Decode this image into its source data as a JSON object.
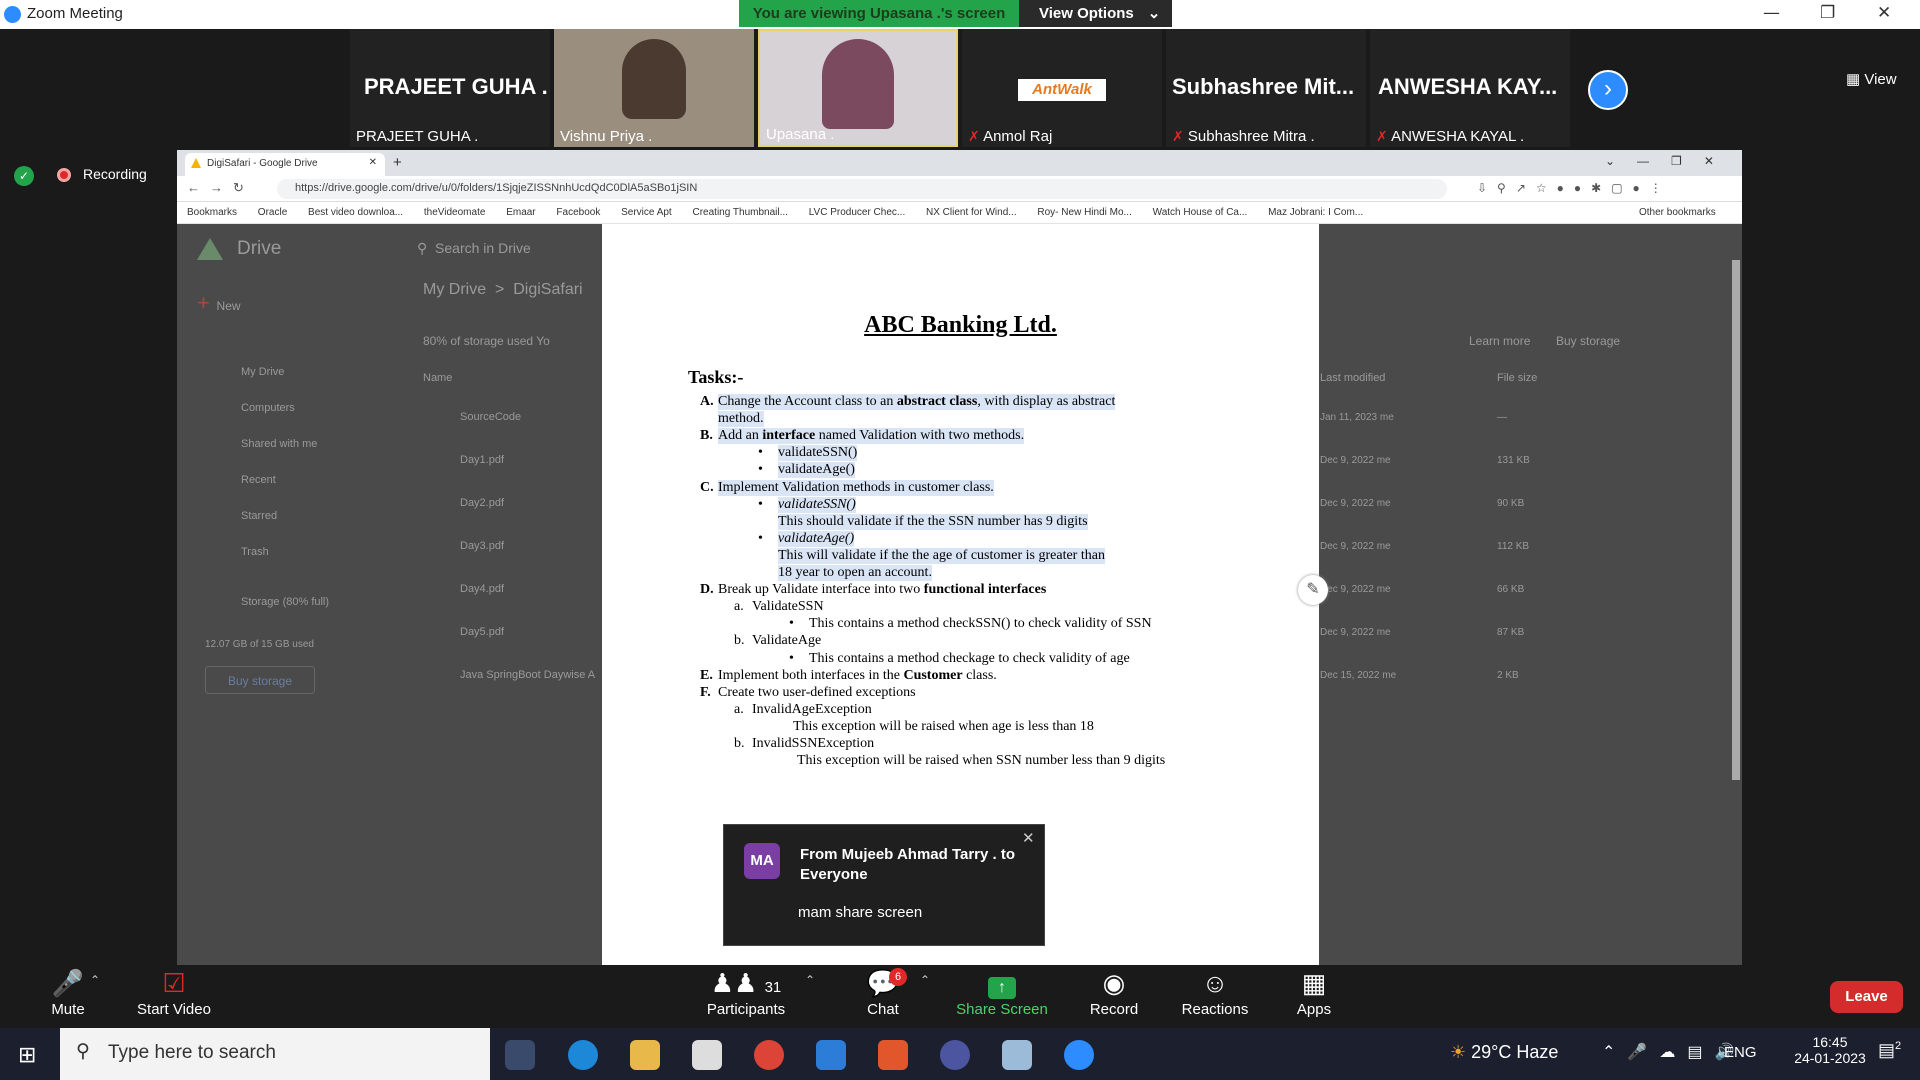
{
  "zoom": {
    "window_title": "Zoom Meeting",
    "viewing_banner": "You are viewing Upasana .'s screen",
    "view_options": "View Options",
    "view_button": "View",
    "recording": "Recording"
  },
  "participants_gallery": [
    {
      "big": "PRAJEET GUHA .",
      "name": "PRAJEET GUHA .",
      "muted": false,
      "video": false
    },
    {
      "big": "",
      "name": "Vishnu Priya .",
      "muted": false,
      "video": true
    },
    {
      "big": "",
      "name": "Upasana .",
      "muted": false,
      "video": true
    },
    {
      "big": "AntWalk",
      "name": "Anmol Raj",
      "muted": true,
      "video": false
    },
    {
      "big": "Subhashree  Mit...",
      "name": "Subhashree Mitra .",
      "muted": true,
      "video": false
    },
    {
      "big": "ANWESHA KAY...",
      "name": "ANWESHA KAYAL .",
      "muted": true,
      "video": false
    }
  ],
  "browser": {
    "tab_title": "DigiSafari - Google Drive",
    "url": "https://drive.google.com/drive/u/0/folders/1SjqjeZISSNnhUcdQdC0DlA5aSBo1jSIN",
    "bookmarks": [
      "Bookmarks",
      "Oracle",
      "Best video downloa...",
      "theVideomate",
      "Emaar",
      "Facebook",
      "Service Apt",
      "Creating Thumbnail...",
      "LVC Producer Chec...",
      "NX Client for Wind...",
      "Roy- New Hindi Mo...",
      "Watch House of Ca...",
      "Maz Jobrani: I Com...",
      "Other bookmarks"
    ]
  },
  "drive": {
    "logo": "Drive",
    "search_placeholder": "Search in Drive",
    "breadcrumb": [
      "My Drive",
      "DigiSafari"
    ],
    "new_button": "New",
    "nav": [
      "My Drive",
      "Computers",
      "Shared with me",
      "Recent",
      "Starred",
      "Trash",
      "Storage (80% full)"
    ],
    "storage_used": "12.07 GB of 15 GB used",
    "buy_storage": "Buy storage",
    "banner": "80% of storage used Yo",
    "banner_learn": "Learn more",
    "banner_buy": "Buy storage",
    "col_name": "Name",
    "col_modified": "Last modified",
    "col_size": "File size",
    "files": [
      {
        "name": "SourceCode",
        "modified": "Jan 11, 2023  me",
        "size": "—"
      },
      {
        "name": "Day1.pdf",
        "modified": "Dec 9, 2022  me",
        "size": "131 KB"
      },
      {
        "name": "Day2.pdf",
        "modified": "Dec 9, 2022  me",
        "size": "90 KB"
      },
      {
        "name": "Day3.pdf",
        "modified": "Dec 9, 2022  me",
        "size": "112 KB"
      },
      {
        "name": "Day4.pdf",
        "modified": "Dec 9, 2022  me",
        "size": "66 KB"
      },
      {
        "name": "Day5.pdf",
        "modified": "Dec 9, 2022  me",
        "size": "87 KB"
      },
      {
        "name": "Java SpringBoot Daywise A",
        "modified": "Dec 15, 2022  me",
        "size": "2 KB"
      }
    ]
  },
  "document": {
    "title": "ABC Banking Ltd.",
    "tasks_heading": "Tasks:-",
    "lines": [
      {
        "t": "A.",
        "text": "Change the Account class to an ",
        "bold": "abstract class",
        "after": ", with display as abstract"
      },
      {
        "t": "",
        "text": "method."
      },
      {
        "t": "B.",
        "text": "Add an ",
        "bold": "interface",
        "after": " named Validation with two methods."
      },
      {
        "t": "•",
        "text": "validateSSN()"
      },
      {
        "t": "•",
        "text": "validateAge()"
      },
      {
        "t": "C.",
        "text": "Implement Validation methods in customer class."
      },
      {
        "t": "•",
        "text": "validateSSN()"
      },
      {
        "t": "",
        "text": "This should validate if the the SSN number has 9 digits"
      },
      {
        "t": "•",
        "text": "validateAge()"
      },
      {
        "t": "",
        "text": "This will validate if the the age of customer is greater than"
      },
      {
        "t": "",
        "text": "18 year to open an account."
      },
      {
        "t": "D.",
        "text": "Break up Validate interface into two ",
        "bold": "functional interfaces",
        "after": ""
      },
      {
        "t": "a.",
        "text": "ValidateSSN"
      },
      {
        "t": "•",
        "text": "This contains a method checkSSN() to check validity of SSN"
      },
      {
        "t": "b.",
        "text": "ValidateAge"
      },
      {
        "t": "•",
        "text": "This contains a method checkage to check validity of age"
      },
      {
        "t": "E.",
        "text": "Implement both interfaces in the ",
        "bold": "Customer",
        "after": " class."
      },
      {
        "t": "F.",
        "text": "Create two user-defined exceptions"
      },
      {
        "t": "a.",
        "text": "InvalidAgeException"
      },
      {
        "t": "",
        "text": "This exception will be raised when age is less than 18"
      },
      {
        "t": "b.",
        "text": "InvalidSSNException"
      },
      {
        "t": "",
        "text": "This exception will be raised when SSN number less than 9 digits"
      }
    ]
  },
  "chat_popup": {
    "avatar": "MA",
    "from": "From Mujeeb Ahmad Tarry . to Everyone",
    "message": "mam share screen"
  },
  "toolbar": {
    "mute": "Mute",
    "start_video": "Start Video",
    "participants": "Participants",
    "participant_count": "31",
    "chat": "Chat",
    "chat_badge": "6",
    "share_screen": "Share Screen",
    "record": "Record",
    "reactions": "Reactions",
    "apps": "Apps",
    "leave": "Leave"
  },
  "taskbar": {
    "search_placeholder": "Type here to search",
    "weather": "29°C  Haze",
    "lang": "ENG",
    "time": "16:45",
    "date": "24-01-2023",
    "notifications": "2"
  }
}
